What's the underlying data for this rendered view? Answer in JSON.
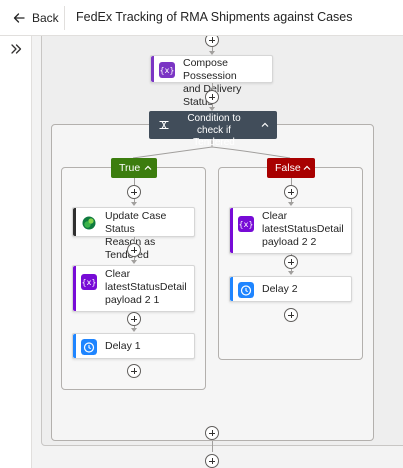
{
  "header": {
    "back_label": "Back",
    "flow_title": "FedEx Tracking of RMA Shipments against Cases"
  },
  "icons": {
    "back": "arrow-left-icon",
    "expand": "double-chevron-right-icon",
    "add": "plus-circle-icon",
    "compose": "curly-braces-icon",
    "condition": "condition-icon",
    "dataverse": "dataverse-icon",
    "variable": "variable-icon",
    "delay": "clock-icon",
    "collapse": "chevron-up-icon"
  },
  "colors": {
    "compose_accent": "#7B35C4",
    "variable_accent": "#770BD6",
    "delay_accent": "#1F85FF",
    "dataverse_accent": "#2F2F2F",
    "condition_header": "#414D5A",
    "true_branch": "#3C7D0E",
    "false_branch": "#A80000"
  },
  "flow": {
    "compose_card": {
      "title": "Compose Possession\nand Delivery Status",
      "icon_glyph": "{x}"
    },
    "condition": {
      "title": "Condition to\ncheck if Tendered"
    },
    "true_branch": {
      "label": "True",
      "actions": [
        {
          "title": "Update Case Status\nReason as Tendered"
        },
        {
          "title": "Clear\nlatestStatusDetail\npayload 2 1",
          "icon_glyph": "{x}"
        },
        {
          "title": "Delay 1"
        }
      ]
    },
    "false_branch": {
      "label": "False",
      "actions": [
        {
          "title": "Clear\nlatestStatusDetail\npayload 2 2",
          "icon_glyph": "{x}"
        },
        {
          "title": "Delay 2"
        }
      ]
    }
  }
}
